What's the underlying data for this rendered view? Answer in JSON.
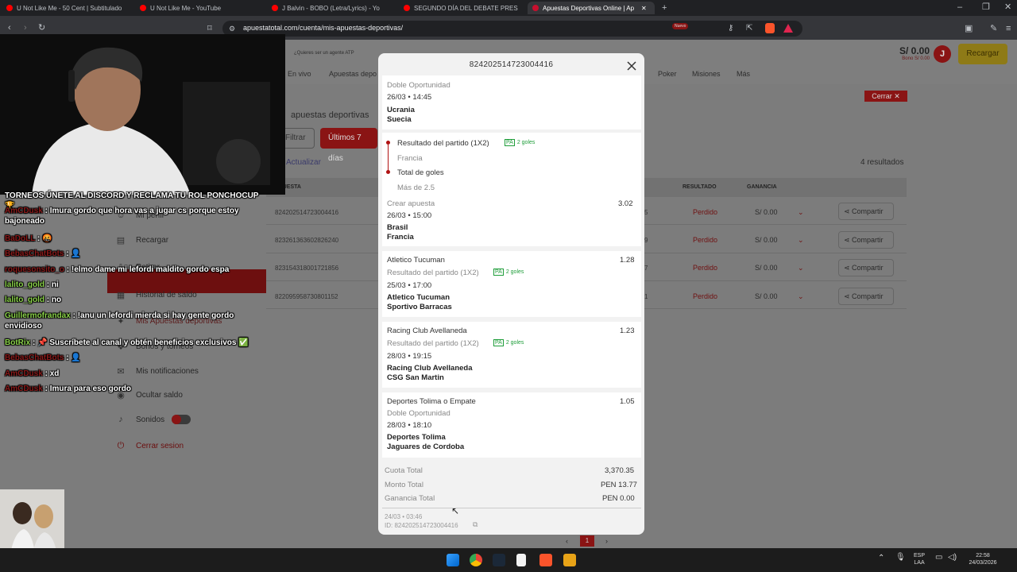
{
  "browser": {
    "tabs": [
      {
        "title": "U Not Like Me - 50 Cent | Subtitulado",
        "color": "#ff0000"
      },
      {
        "title": "U Not Like Me - YouTube",
        "color": "#ff0000"
      },
      {
        "title": "J Balvin - BOBO (Letra/Lyrics) - Yo",
        "color": "#ff0000"
      },
      {
        "title": "SEGUNDO DÍA DEL DEBATE PRES",
        "color": "#ff0000"
      },
      {
        "title": "Apuestas Deportivas Online | Ap",
        "color": "#c8102e"
      }
    ],
    "new_tab": "+",
    "url": "apuestatotal.com/cuenta/mis-apuestas-deportivas/"
  },
  "site": {
    "promo": "¿Quieres ser un agente ATP",
    "nav": [
      "En vivo",
      "Apuestas depo",
      "Poker",
      "Misiones",
      "Más"
    ],
    "nuevo_badge": "Nuevo",
    "balance": "S/ 0.00",
    "bono": "Bono S/ 0.00",
    "avatar_letter": "J",
    "recargar": "Recargar",
    "cerrar": "Cerrar ✕",
    "section_title": "apuestas deportivas",
    "filtrar": "Filtrar",
    "ultimos": "Últimos 7 días",
    "actualizar": "Actualizar",
    "resultados": "4 resultados",
    "table_headers": {
      "apuesta": "APUESTA",
      "resultado": "RESULTADO",
      "ganancia": "GANANCIA"
    },
    "rows": [
      {
        "id": "824202514723004416",
        "col": "5",
        "result": "Perdido",
        "gain": "S/ 0.00",
        "share": "Compartir"
      },
      {
        "id": "823261363602826240",
        "col": "9",
        "result": "Perdido",
        "gain": "S/ 0.00",
        "share": "Compartir"
      },
      {
        "id": "823154318001721856",
        "col": "7",
        "result": "Perdido",
        "gain": "S/ 0.00",
        "share": "Compartir"
      },
      {
        "id": "822095958730801152",
        "col": "1",
        "result": "Perdido",
        "gain": "S/ 0.00",
        "share": "Compartir"
      }
    ],
    "page_num": "1"
  },
  "menu": [
    {
      "label": "Mi perfil",
      "icon": "user-icon"
    },
    {
      "label": "Recargar",
      "icon": "wallet-icon"
    },
    {
      "label": "Retirar",
      "icon": "withdraw-icon"
    },
    {
      "label": "Historial de saldo",
      "icon": "history-icon"
    },
    {
      "label": "Mis Apuestas deportivas",
      "icon": "ticket-icon"
    },
    {
      "label": "Bonos y torneos",
      "icon": "gift-icon"
    },
    {
      "label": "Mis notificaciones",
      "icon": "mail-icon"
    },
    {
      "label": "Ocultar saldo",
      "icon": "eye-icon"
    },
    {
      "label": "Sonidos",
      "icon": "speaker-icon"
    },
    {
      "label": "Cerrar sesion",
      "icon": "power-icon"
    }
  ],
  "chat": [
    {
      "user": "",
      "text": "TORNEOS ÚNETE AL DISCORD Y RECLAMA TU ROL PONCHOCUP 🏆"
    },
    {
      "user": "AmCDusk",
      "text": "Imura gordo que hora vas a jugar cs porque estoy bajoneado"
    },
    {
      "user": "BaDoLL",
      "text": "🤬"
    },
    {
      "user": "BebasChatBots",
      "text": "👤"
    },
    {
      "user": "roquesonsito_o",
      "text": "!elmo dame mi lefordi maldito gordo espa"
    },
    {
      "user": "lalito_gold",
      "text": "ni"
    },
    {
      "user": "lalito_gold",
      "text": "no"
    },
    {
      "user": "Guillermofrandax",
      "text": "!anu un lefordi mierda si hay gente gordo envidioso"
    },
    {
      "user": "BotRix",
      "text": "📌 Suscríbete al canal y obtén beneficios exclusivos ✅"
    },
    {
      "user": "BebasChatBots",
      "text": "👤"
    },
    {
      "user": "AmCDusk",
      "text": "xd"
    },
    {
      "user": "AmCDusk",
      "text": "Imura para eso gordo"
    }
  ],
  "modal": {
    "title": "824202514723004416",
    "bets": [
      {
        "market": "Doble Oportunidad",
        "datetime": "26/03 • 14:45",
        "team1": "Ucrania",
        "team2": "Suecia"
      },
      {
        "sub1": "Resultado del partido (1X2)",
        "sub1_badge": "PA",
        "sub1_goles": "2 goles",
        "sub1_pick": "Francia",
        "sub2": "Total de goles",
        "sub2_pick": "Más de 2.5",
        "market": "Crear apuesta",
        "odds": "3.02",
        "datetime": "26/03 • 15:00",
        "team1": "Brasil",
        "team2": "Francia"
      },
      {
        "selection": "Atletico Tucuman",
        "odds": "1.28",
        "market": "Resultado del partido (1X2)",
        "badge": "PA",
        "goles": "2 goles",
        "datetime": "25/03 • 17:00",
        "team1": "Atletico Tucuman",
        "team2": "Sportivo Barracas"
      },
      {
        "selection": "Racing Club Avellaneda",
        "odds": "1.23",
        "market": "Resultado del partido (1X2)",
        "badge": "PA",
        "goles": "2 goles",
        "datetime": "28/03 • 19:15",
        "team1": "Racing Club Avellaneda",
        "team2": "CSG San Martin"
      },
      {
        "selection": "Deportes Tolima o Empate",
        "odds": "1.05",
        "market": "Doble Oportunidad",
        "datetime": "28/03 • 18:10",
        "team1": "Deportes Tolima",
        "team2": "Jaguares de Cordoba"
      }
    ],
    "totals": {
      "cuota_label": "Cuota Total",
      "cuota": "3,370.35",
      "monto_label": "Monto Total",
      "monto": "PEN 13.77",
      "ganancia_label": "Ganancia Total",
      "ganancia": "PEN 0.00"
    },
    "footer_datetime": "24/03 • 03:46",
    "footer_id": "ID: 824202514723004416"
  },
  "taskbar": {
    "lang": "ESP",
    "lang2": "LAA",
    "time": "22:58",
    "date": "24/03/2026"
  }
}
